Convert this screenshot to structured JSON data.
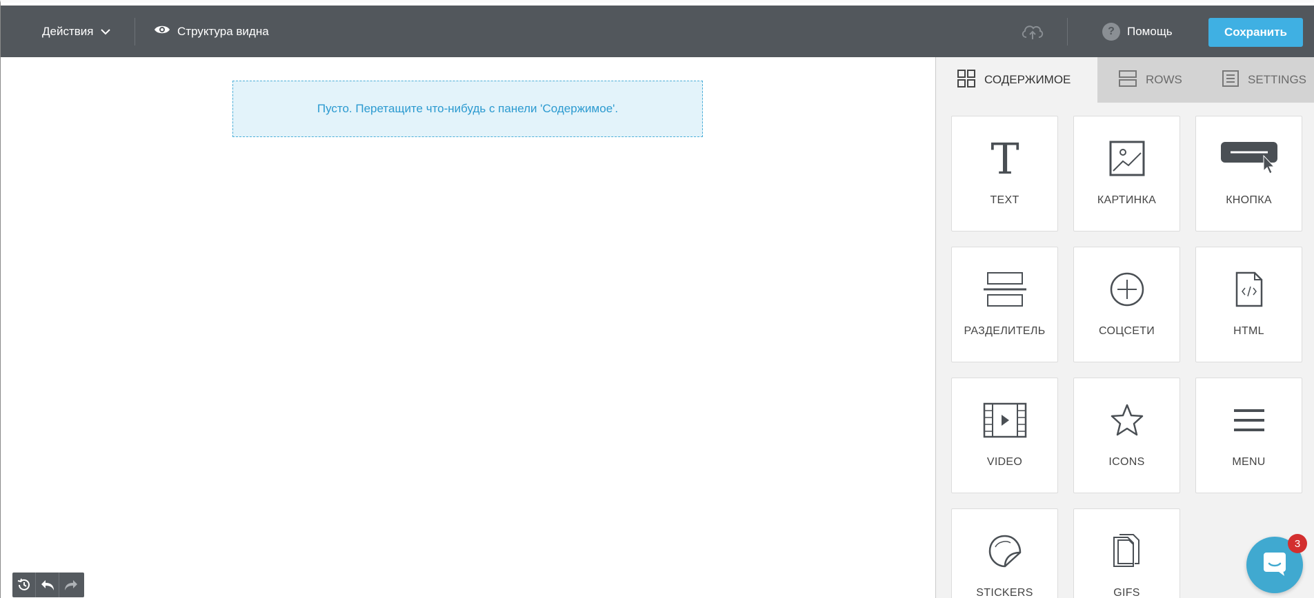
{
  "topbar": {
    "actions_label": "Действия",
    "structure_label": "Структура видна",
    "help_label": "Помощь",
    "save_label": "Сохранить"
  },
  "canvas": {
    "empty_message": "Пусто. Перетащите что-нибудь с панели 'Содержимое'."
  },
  "panel": {
    "tabs": [
      {
        "label": "СОДЕРЖИМОЕ",
        "icon": "grid-icon",
        "active": true
      },
      {
        "label": "ROWS",
        "icon": "rows-icon",
        "active": false
      },
      {
        "label": "SETTINGS",
        "icon": "settings-doc-icon",
        "active": false
      }
    ],
    "blocks": [
      {
        "label": "TEXT",
        "icon": "text-icon"
      },
      {
        "label": "КАРТИНКА",
        "icon": "image-icon"
      },
      {
        "label": "КНОПКА",
        "icon": "button-icon"
      },
      {
        "label": "РАЗДЕЛИТЕЛЬ",
        "icon": "divider-icon"
      },
      {
        "label": "СОЦСЕТИ",
        "icon": "social-plus-icon"
      },
      {
        "label": "HTML",
        "icon": "html-file-icon"
      },
      {
        "label": "VIDEO",
        "icon": "video-icon"
      },
      {
        "label": "ICONS",
        "icon": "star-icon"
      },
      {
        "label": "MENU",
        "icon": "menu-icon"
      },
      {
        "label": "STICKERS",
        "icon": "sticker-icon"
      },
      {
        "label": "GIFS",
        "icon": "gif-files-icon"
      }
    ]
  },
  "chat": {
    "badge_count": "3"
  },
  "colors": {
    "topbar_bg": "#52575c",
    "save_button": "#3fb0e3",
    "drop_zone_bg": "#e3f3fa",
    "drop_zone_text": "#2b9ad0",
    "chat_bubble": "#40a9d0",
    "badge": "#d32f2f"
  }
}
